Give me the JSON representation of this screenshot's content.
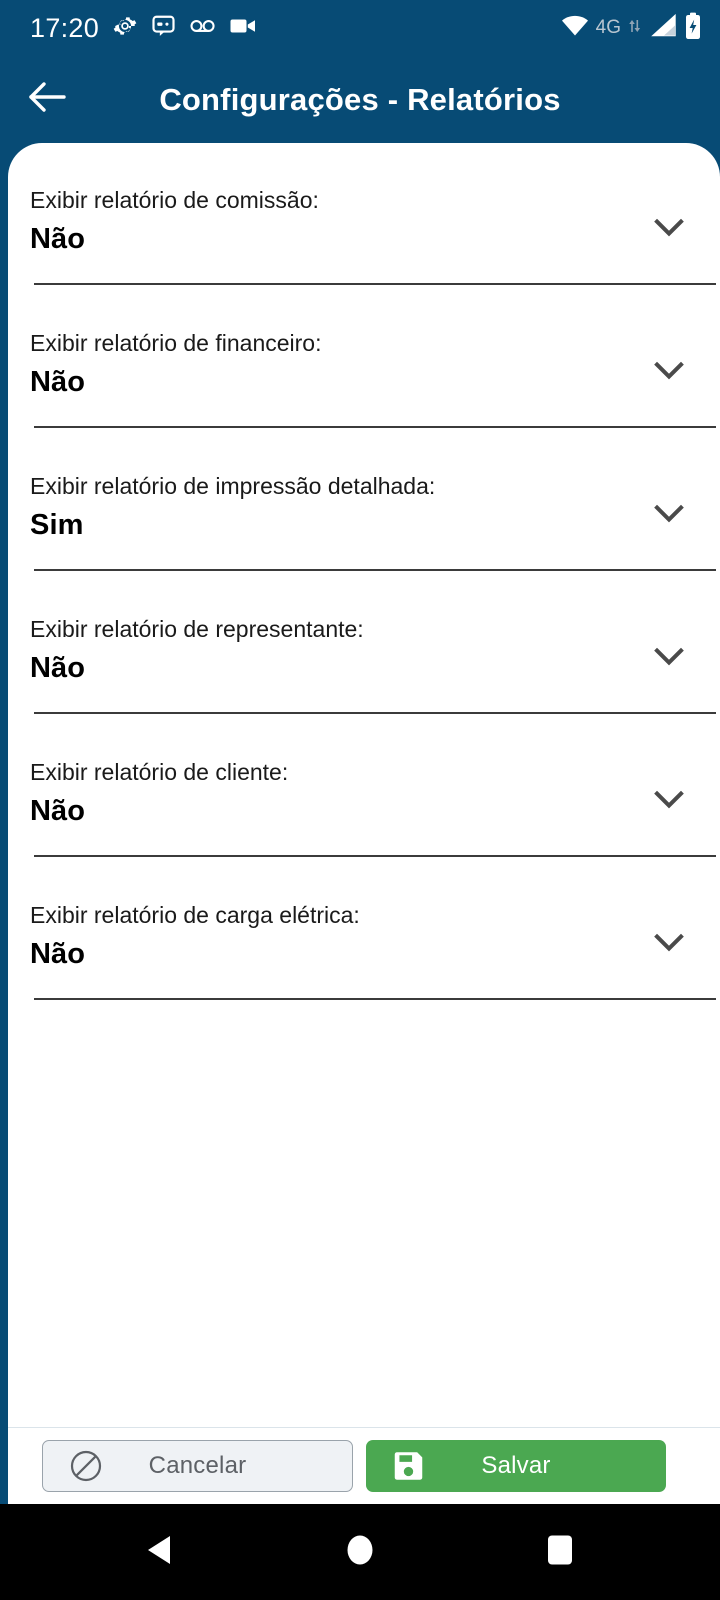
{
  "status_bar": {
    "clock": "17:20",
    "left_icons": [
      "settings-gear-icon",
      "chat-message-icon",
      "voicemail-icon",
      "video-camera-icon"
    ],
    "network_label": "4G",
    "right_icons": [
      "wifi-icon",
      "data-transfer-icon",
      "cellular-signal-icon",
      "battery-charging-icon"
    ]
  },
  "app_bar": {
    "back_icon": "arrow-left-icon",
    "title": "Configurações - Relatórios"
  },
  "settings": [
    {
      "label": "Exibir relatório de comissão:",
      "value": "Não",
      "icon": "chevron-down-icon"
    },
    {
      "label": "Exibir relatório de financeiro:",
      "value": "Não",
      "icon": "chevron-down-icon"
    },
    {
      "label": "Exibir relatório de impressão detalhada:",
      "value": "Sim",
      "icon": "chevron-down-icon"
    },
    {
      "label": "Exibir relatório de representante:",
      "value": "Não",
      "icon": "chevron-down-icon"
    },
    {
      "label": "Exibir relatório de cliente:",
      "value": "Não",
      "icon": "chevron-down-icon"
    },
    {
      "label": "Exibir relatório de carga elétrica:",
      "value": "Não",
      "icon": "chevron-down-icon"
    }
  ],
  "actions": {
    "cancel_label": "Cancelar",
    "cancel_icon": "block-prohibited-icon",
    "save_label": "Salvar",
    "save_icon": "floppy-disk-save-icon"
  },
  "nav_bar": {
    "back_label": "back-triangle-icon",
    "home_label": "home-circle-icon",
    "recents_label": "recents-square-icon"
  },
  "colors": {
    "header_blue": "#074B75",
    "save_green": "#4BA851",
    "cancel_gray": "#EFF2F5",
    "divider": "#3B3B3B",
    "nav_black": "#000000"
  }
}
